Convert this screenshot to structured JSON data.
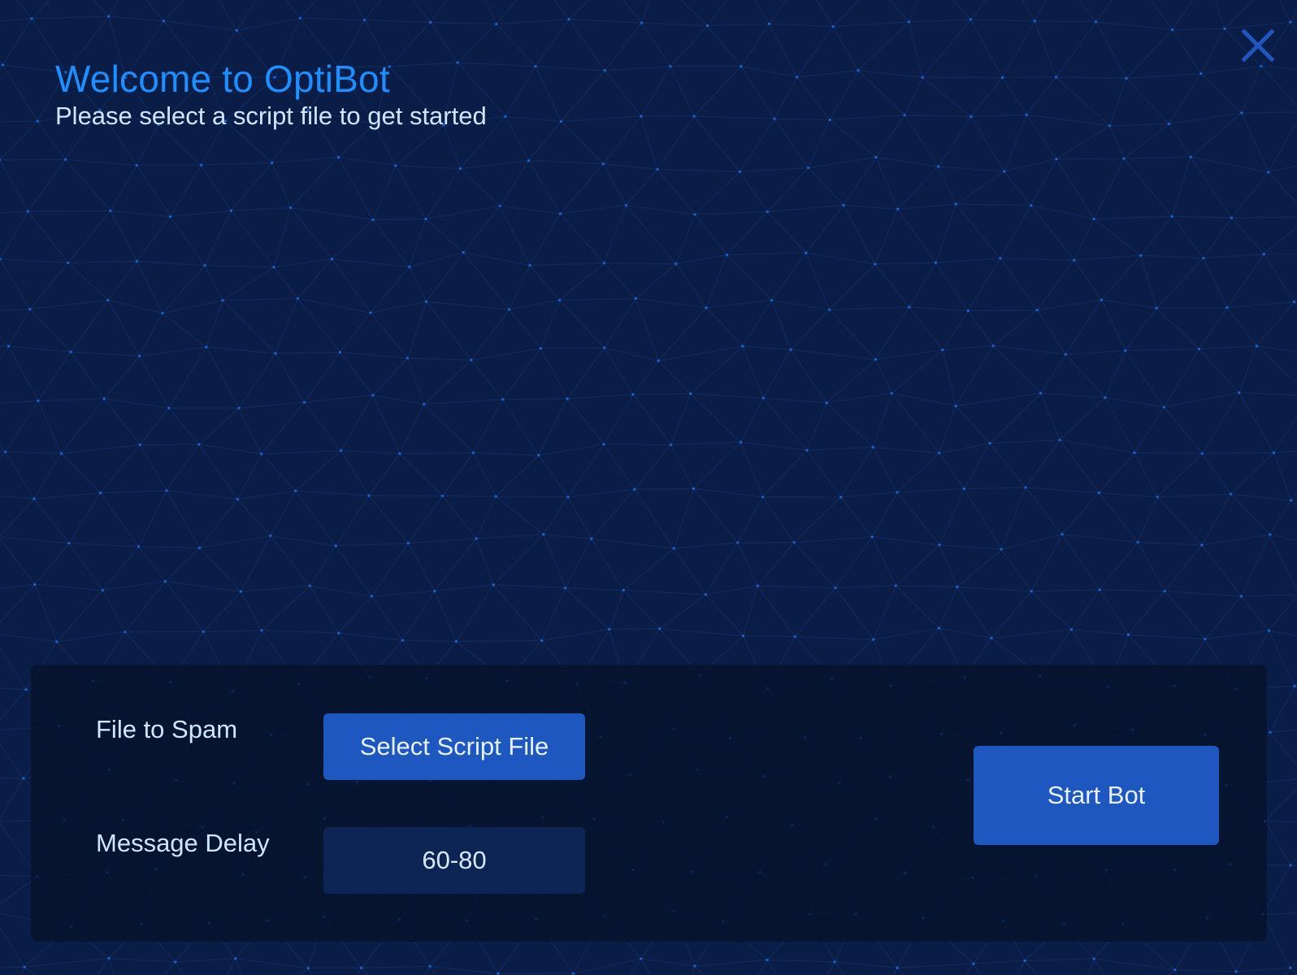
{
  "header": {
    "title": "Welcome to OptiBot",
    "subtitle": "Please select a script file to get started"
  },
  "close": {
    "icon": "close-icon"
  },
  "panel": {
    "file_label": "File to Spam",
    "select_button_label": "Select Script File",
    "delay_label": "Message Delay",
    "delay_value": "60-80",
    "start_button_label": "Start Bot"
  },
  "colors": {
    "background": "#0a1d47",
    "accent": "#1e8fff",
    "button": "#1f57c0",
    "panel": "#061028",
    "text": "#cfe6ff"
  }
}
